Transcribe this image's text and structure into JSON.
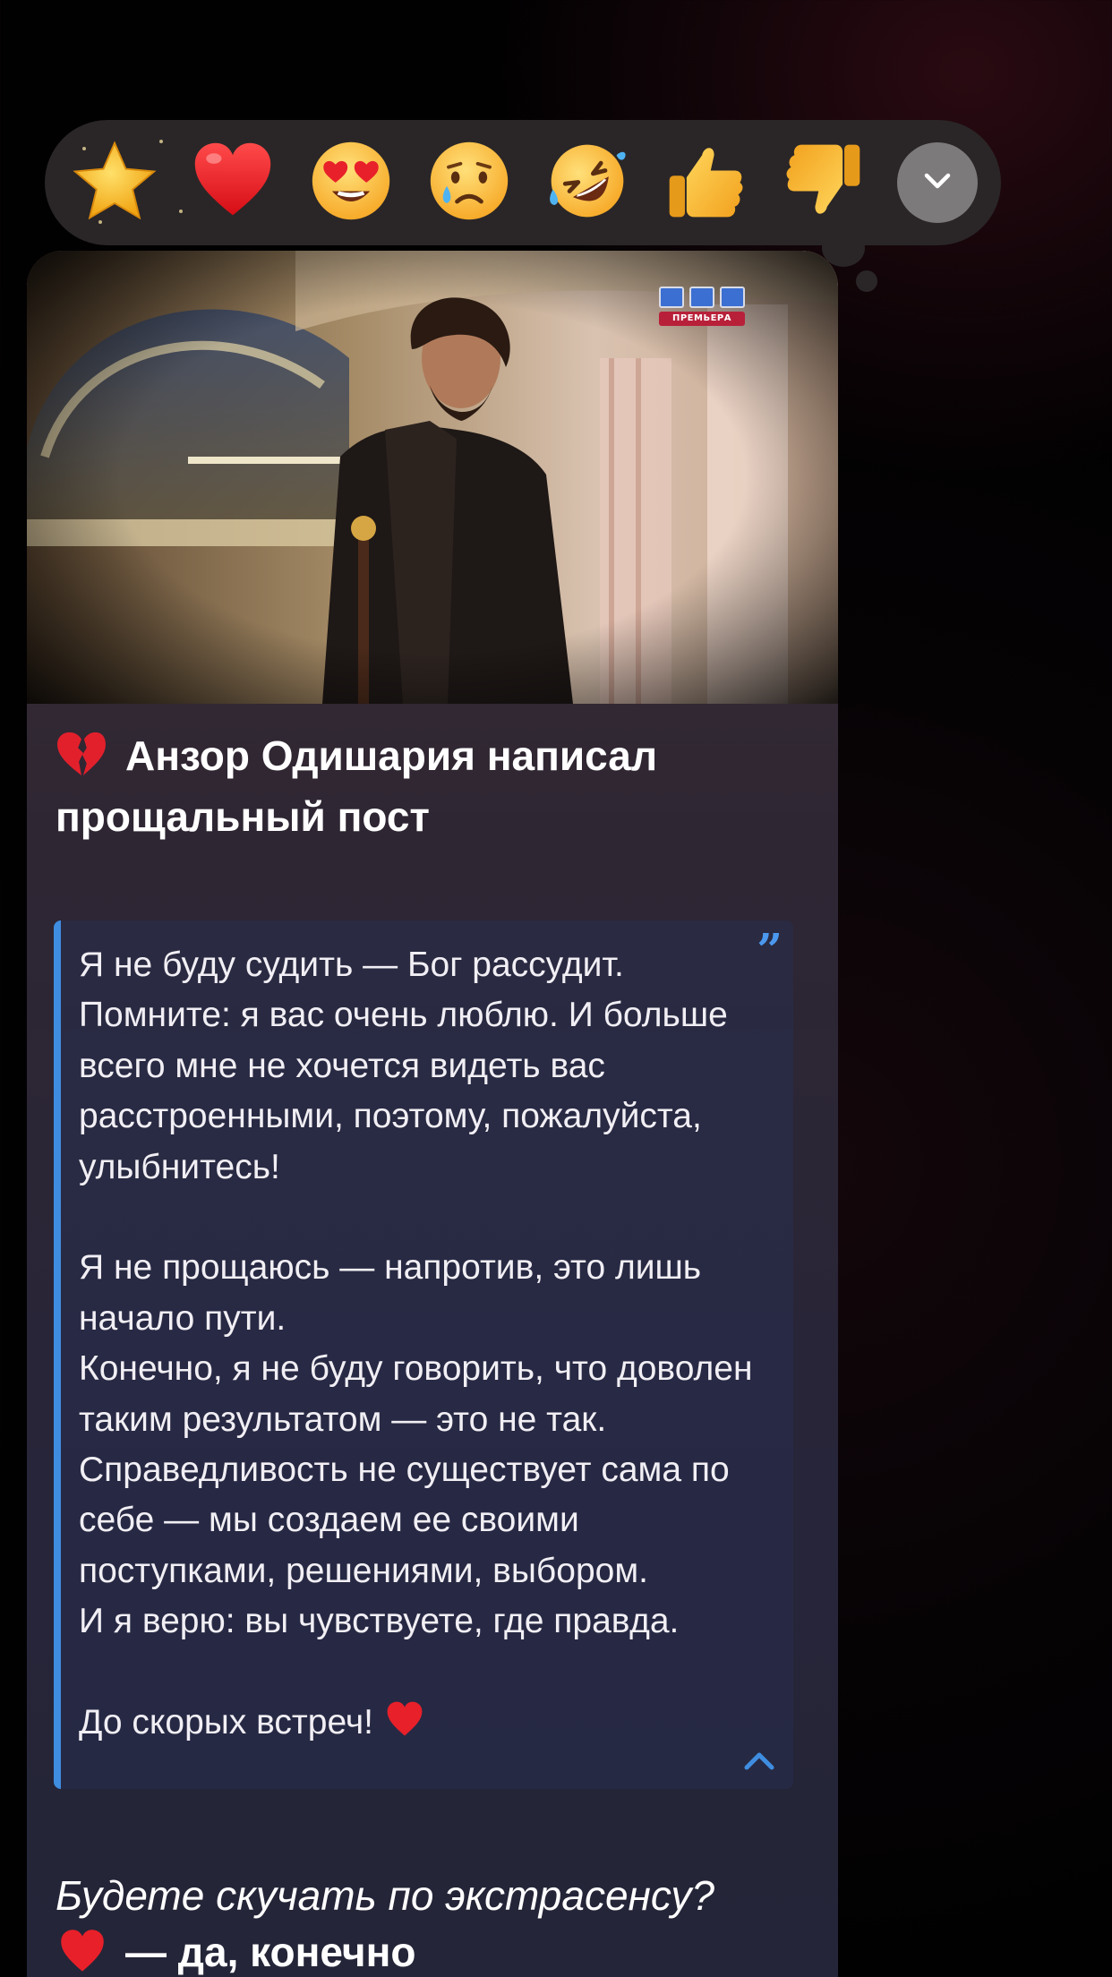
{
  "reactions": [
    {
      "icon": "star-icon",
      "label": "star"
    },
    {
      "icon": "red-heart-icon",
      "label": "heart"
    },
    {
      "icon": "heart-eyes-icon",
      "label": "heart-eyes"
    },
    {
      "icon": "crying-face-icon",
      "label": "cry"
    },
    {
      "icon": "rofl-icon",
      "label": "rofl"
    },
    {
      "icon": "thumbs-up-icon",
      "label": "thumbs-up"
    },
    {
      "icon": "thumbs-down-icon",
      "label": "thumbs-down"
    },
    {
      "icon": "chevron-down-icon",
      "label": "more"
    }
  ],
  "message": {
    "photo": {
      "channel_logo_text": "ПРЕМЬЕРА"
    },
    "title_icon": "broken-heart-icon",
    "title": "Анзор Одишария написал прощальный пост",
    "quote": {
      "text": "Я не буду судить — Бог рассудит.\nПомните: я вас очень люблю. И больше всего мне не хочется видеть вас расстроенными, поэтому, пожалуйста, улыбнитесь!\n\nЯ не прощаюсь — напротив, это лишь начало пути.\nКонечно, я не буду говорить, что доволен таким результатом — это не так.\nСправедливость не существует сама по себе — мы создаем ее своими поступками, решениями, выбором.\nИ я верю: вы чувствуете, где правда.\n\nДо скорых встреч!",
      "quote_icon": "quote-mark-icon",
      "collapse_icon": "chevron-up-icon"
    },
    "poll_question": "Будете скучать по экстрасенсу?",
    "poll_options": [
      {
        "icon": "red-heart-icon",
        "text": "— да, конечно"
      }
    ]
  },
  "colors": {
    "accent": "#3f8de0",
    "reaction_bar": "#2a2627"
  }
}
